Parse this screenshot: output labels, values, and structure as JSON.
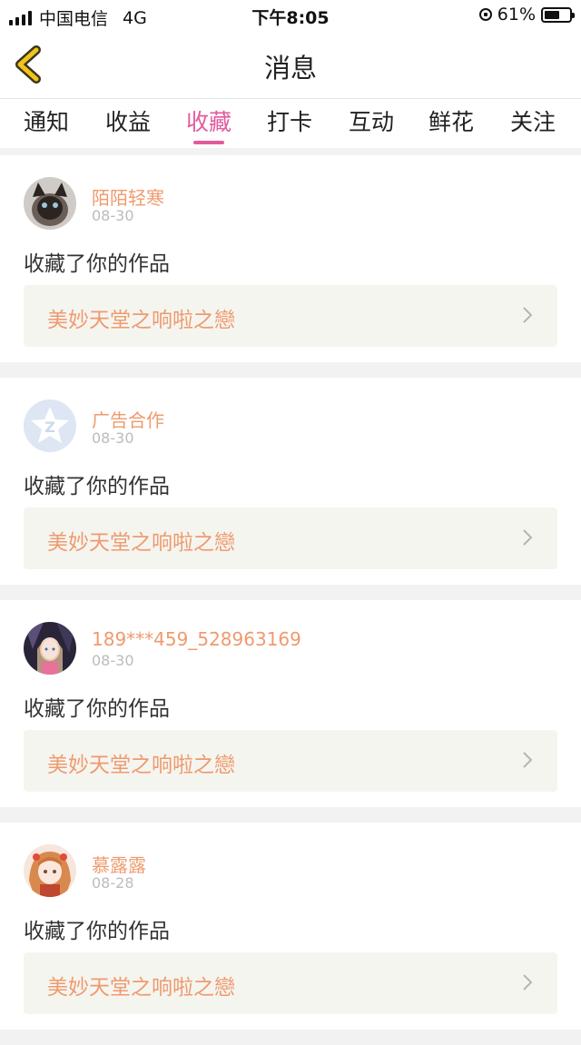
{
  "status_bar": {
    "carrier": "中国电信",
    "network": "4G",
    "time": "下午8:05",
    "battery_percent": "61%",
    "battery_level": 0.61
  },
  "header": {
    "title": "消息",
    "back_icon": "back-chevron-icon"
  },
  "tabs": [
    {
      "label": "通知",
      "active": false
    },
    {
      "label": "收益",
      "active": false
    },
    {
      "label": "收藏",
      "active": true
    },
    {
      "label": "打卡",
      "active": false
    },
    {
      "label": "互动",
      "active": false
    },
    {
      "label": "鲜花",
      "active": false
    },
    {
      "label": "关注",
      "active": false
    }
  ],
  "notifications": [
    {
      "username": "陌陌轻寒",
      "date": "08-30",
      "action": "收藏了你的作品",
      "work_title": "美妙天堂之响啦之戀"
    },
    {
      "username": "广告合作",
      "date": "08-30",
      "action": "收藏了你的作品",
      "work_title": "美妙天堂之响啦之戀"
    },
    {
      "username": "189***459_528963169",
      "date": "08-30",
      "action": "收藏了你的作品",
      "work_title": "美妙天堂之响啦之戀"
    },
    {
      "username": "慕露露",
      "date": "08-28",
      "action": "收藏了你的作品",
      "work_title": "美妙天堂之响啦之戀"
    }
  ],
  "colors": {
    "accent": "#e35a9c",
    "username": "#ef9a6e",
    "work_bg": "#f5f5f0",
    "back_icon": "#f0c419"
  }
}
